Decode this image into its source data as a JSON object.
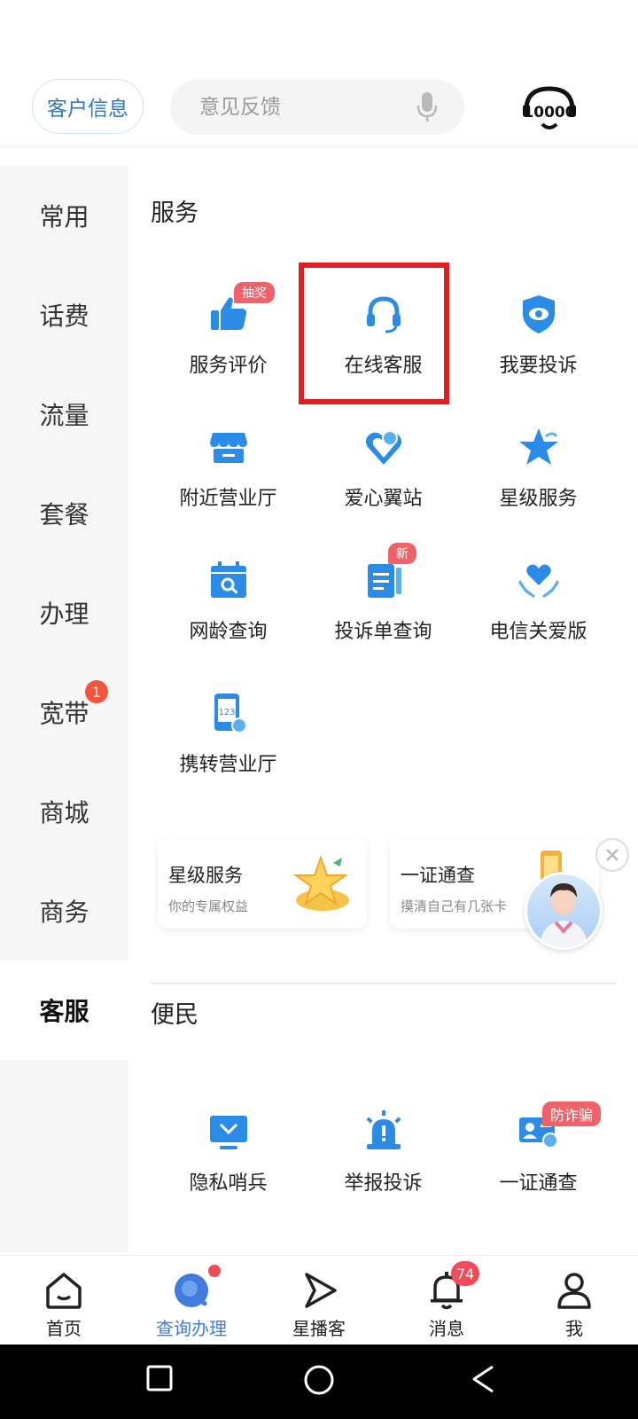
{
  "header": {
    "customer_info_label": "客户信息",
    "search_placeholder": "意见反馈",
    "hotline_text": "10000"
  },
  "sidenav": {
    "items": [
      {
        "label": "常用"
      },
      {
        "label": "话费"
      },
      {
        "label": "流量"
      },
      {
        "label": "套餐"
      },
      {
        "label": "办理"
      },
      {
        "label": "宽带",
        "badge": "1"
      },
      {
        "label": "商城"
      },
      {
        "label": "商务"
      },
      {
        "label": "客服",
        "active": true
      }
    ]
  },
  "service": {
    "title": "服务",
    "items": [
      {
        "label": "服务评价",
        "icon": "thumbs-up-icon",
        "tag": "抽奖"
      },
      {
        "label": "在线客服",
        "icon": "headset-icon"
      },
      {
        "label": "我要投诉",
        "icon": "shield-eye-icon"
      },
      {
        "label": "附近营业厅",
        "icon": "store-icon"
      },
      {
        "label": "爱心翼站",
        "icon": "heart-pin-icon"
      },
      {
        "label": "星级服务",
        "icon": "star-icon"
      },
      {
        "label": "网龄查询",
        "icon": "calendar-search-icon"
      },
      {
        "label": "投诉单查询",
        "icon": "document-icon",
        "tag": "新"
      },
      {
        "label": "电信关爱版",
        "icon": "heart-hands-icon"
      },
      {
        "label": "携转营业厅",
        "icon": "phone-transfer-icon"
      }
    ]
  },
  "promo_cards": [
    {
      "title": "星级服务",
      "subtitle": "你的专属权益"
    },
    {
      "title": "一证通查",
      "subtitle": "摸清自己有几张卡"
    }
  ],
  "convenience": {
    "title": "便民",
    "items": [
      {
        "label": "隐私哨兵",
        "icon": "monitor-icon"
      },
      {
        "label": "举报投诉",
        "icon": "alarm-icon"
      },
      {
        "label": "一证通查",
        "icon": "id-card-icon",
        "tag": "防诈骗"
      }
    ]
  },
  "tabbar": {
    "tabs": [
      {
        "label": "首页",
        "icon": "home-icon"
      },
      {
        "label": "查询办理",
        "icon": "search-orb-icon",
        "active": true
      },
      {
        "label": "星播客",
        "icon": "play-icon"
      },
      {
        "label": "消息",
        "icon": "bell-icon",
        "badge": "74"
      },
      {
        "label": "我",
        "icon": "person-icon"
      }
    ]
  },
  "colors": {
    "accent": "#3f7cdd",
    "icon_blue": "#2b8ce8",
    "highlight": "#e02020",
    "badge": "#f24b5a"
  }
}
